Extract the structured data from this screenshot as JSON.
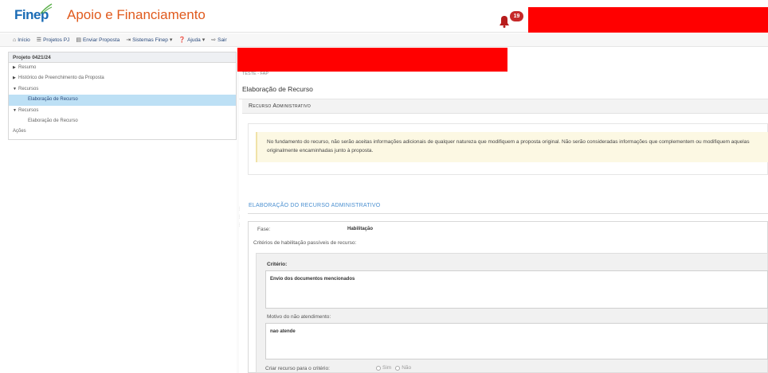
{
  "header": {
    "logo_text": "Finep",
    "app_title": "Apoio e Financiamento",
    "notification_count": "19"
  },
  "toolbar": {
    "items": [
      {
        "label": "Início",
        "icon": "home-icon"
      },
      {
        "label": "Projetos PJ",
        "icon": "list-icon"
      },
      {
        "label": "Enviar Proposta",
        "icon": "document-icon"
      },
      {
        "label": "Sistemas Finep",
        "icon": "login-icon"
      },
      {
        "label": "Ajuda",
        "icon": "help-icon"
      },
      {
        "label": "Sair",
        "icon": "logout-icon"
      }
    ]
  },
  "tree": {
    "title": "Projeto 0421/24",
    "items": [
      {
        "label": "Resumo",
        "caret": "▶"
      },
      {
        "label": "Histórico de Preenchimento da Proposta",
        "caret": "▶"
      },
      {
        "label": "Recursos",
        "caret": "▼"
      },
      {
        "label": "Elaboração de Recurso",
        "caret": ""
      },
      {
        "label": "Recursos",
        "caret": "▼"
      },
      {
        "label": "Elaboração de Recurso",
        "caret": ""
      },
      {
        "label": "Ações",
        "caret": ""
      }
    ]
  },
  "main": {
    "breadcrumb": "TESTE - FAP",
    "title": "Elaboração de Recurso",
    "section_title": "Recurso Administrativo",
    "notice": "No fundamento do recurso, não serão aceitas informações adicionais de qualquer natureza que modifiquem a proposta original. Não serão consideradas informações que complementem ou modifiquem aquelas originalmente encaminhadas junto à proposta.",
    "sub_heading": "ELABORAÇÃO DO RECURSO ADMINISTRATIVO",
    "fase_label": "Fase:",
    "fase_value": "Habilitação",
    "criteria_list_label": "Critérios de habilitação passíveis de recurso:",
    "criterio_label": "Critério:",
    "criterio_value": "Envio dos documentos mencionados",
    "motivo_label": "Motivo do não atendimento:",
    "motivo_value": "nao atende",
    "criar_label": "Criar recurso para o critério:",
    "radio_sim": "Sim",
    "radio_nao": "Não"
  },
  "colors": {
    "brand_blue": "#1a6bb5",
    "brand_orange": "#e05a1d",
    "redaction": "#ff0000",
    "selected_row": "#bde0f5",
    "notice_bg": "#fcf8e3"
  }
}
